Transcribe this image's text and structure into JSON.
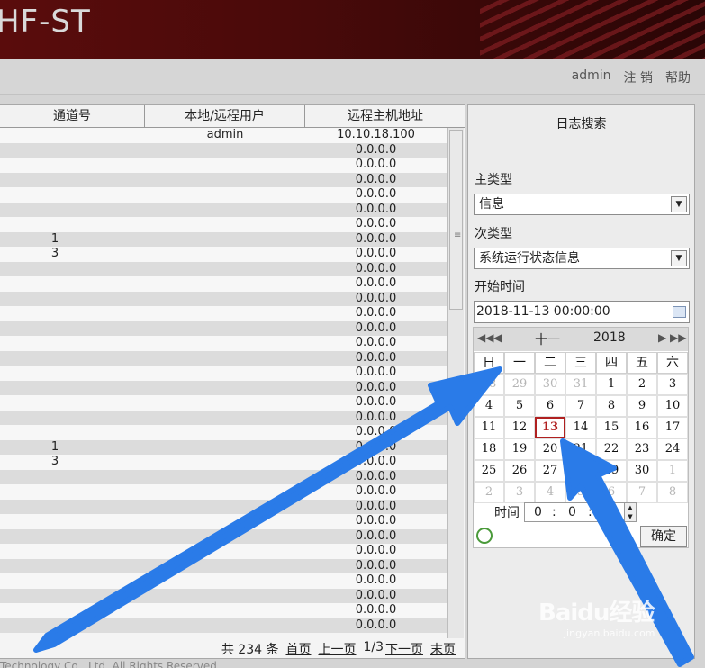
{
  "header": {
    "title": "HF-ST"
  },
  "topnav": {
    "user": "admin",
    "logout": "注 销",
    "help": "帮助"
  },
  "table": {
    "columns": [
      "通道号",
      "本地/远程用户",
      "远程主机地址"
    ],
    "rows": [
      {
        "channel": "",
        "user": "admin",
        "host": "10.10.18.100"
      },
      {
        "channel": "",
        "user": "",
        "host": "0.0.0.0"
      },
      {
        "channel": "",
        "user": "",
        "host": "0.0.0.0"
      },
      {
        "channel": "",
        "user": "",
        "host": "0.0.0.0"
      },
      {
        "channel": "",
        "user": "",
        "host": "0.0.0.0"
      },
      {
        "channel": "",
        "user": "",
        "host": "0.0.0.0"
      },
      {
        "channel": "",
        "user": "",
        "host": "0.0.0.0"
      },
      {
        "channel": "1",
        "user": "",
        "host": "0.0.0.0"
      },
      {
        "channel": "3",
        "user": "",
        "host": "0.0.0.0"
      },
      {
        "channel": "",
        "user": "",
        "host": "0.0.0.0"
      },
      {
        "channel": "",
        "user": "",
        "host": "0.0.0.0"
      },
      {
        "channel": "",
        "user": "",
        "host": "0.0.0.0"
      },
      {
        "channel": "",
        "user": "",
        "host": "0.0.0.0"
      },
      {
        "channel": "",
        "user": "",
        "host": "0.0.0.0"
      },
      {
        "channel": "",
        "user": "",
        "host": "0.0.0.0"
      },
      {
        "channel": "",
        "user": "",
        "host": "0.0.0.0"
      },
      {
        "channel": "",
        "user": "",
        "host": "0.0.0.0"
      },
      {
        "channel": "",
        "user": "",
        "host": "0.0.0.0"
      },
      {
        "channel": "",
        "user": "",
        "host": "0.0.0.0"
      },
      {
        "channel": "",
        "user": "",
        "host": "0.0.0.0"
      },
      {
        "channel": "",
        "user": "",
        "host": "0.0.0.0"
      },
      {
        "channel": "1",
        "user": "",
        "host": "0.0.0.0"
      },
      {
        "channel": "3",
        "user": "",
        "host": "0.0.0.0"
      },
      {
        "channel": "",
        "user": "",
        "host": "0.0.0.0"
      },
      {
        "channel": "",
        "user": "",
        "host": "0.0.0.0"
      },
      {
        "channel": "",
        "user": "",
        "host": "0.0.0.0"
      },
      {
        "channel": "",
        "user": "",
        "host": "0.0.0.0"
      },
      {
        "channel": "",
        "user": "",
        "host": "0.0.0.0"
      },
      {
        "channel": "",
        "user": "",
        "host": "0.0.0.0"
      },
      {
        "channel": "",
        "user": "",
        "host": "0.0.0.0"
      },
      {
        "channel": "",
        "user": "",
        "host": "0.0.0.0"
      },
      {
        "channel": "",
        "user": "",
        "host": "0.0.0.0"
      },
      {
        "channel": "",
        "user": "",
        "host": "0.0.0.0"
      },
      {
        "channel": "",
        "user": "",
        "host": "0.0.0.0"
      }
    ]
  },
  "pager": {
    "total": "共 234 条",
    "first": "首页",
    "prev": "上一页",
    "page": "1/3",
    "next": "下一页",
    "last": "末页"
  },
  "footer": {
    "copyright": "Technology Co., Ltd. All Rights Reserved"
  },
  "search_panel": {
    "title": "日志搜索",
    "main_type_label": "主类型",
    "main_type_value": "信息",
    "sub_type_label": "次类型",
    "sub_type_value": "系统运行状态信息",
    "start_time_label": "开始时间",
    "start_time_value": "2018-11-13 00:00:00",
    "ok_label": "确定"
  },
  "calendar": {
    "month": "十一",
    "year": "2018",
    "weekdays": [
      "日",
      "一",
      "二",
      "三",
      "四",
      "五",
      "六"
    ],
    "weeks": [
      [
        {
          "d": "28",
          "dim": true
        },
        {
          "d": "29",
          "dim": true
        },
        {
          "d": "30",
          "dim": true
        },
        {
          "d": "31",
          "dim": true
        },
        {
          "d": "1"
        },
        {
          "d": "2"
        },
        {
          "d": "3"
        }
      ],
      [
        {
          "d": "4"
        },
        {
          "d": "5"
        },
        {
          "d": "6"
        },
        {
          "d": "7"
        },
        {
          "d": "8"
        },
        {
          "d": "9"
        },
        {
          "d": "10"
        }
      ],
      [
        {
          "d": "11"
        },
        {
          "d": "12"
        },
        {
          "d": "13",
          "today": true
        },
        {
          "d": "14"
        },
        {
          "d": "15"
        },
        {
          "d": "16"
        },
        {
          "d": "17"
        }
      ],
      [
        {
          "d": "18"
        },
        {
          "d": "19"
        },
        {
          "d": "20"
        },
        {
          "d": "21"
        },
        {
          "d": "22"
        },
        {
          "d": "23"
        },
        {
          "d": "24"
        }
      ],
      [
        {
          "d": "25"
        },
        {
          "d": "26"
        },
        {
          "d": "27"
        },
        {
          "d": "28"
        },
        {
          "d": "29"
        },
        {
          "d": "30"
        },
        {
          "d": "1",
          "dim": true
        }
      ],
      [
        {
          "d": "2",
          "dim": true
        },
        {
          "d": "3",
          "dim": true
        },
        {
          "d": "4",
          "dim": true
        },
        {
          "d": "5",
          "dim": true
        },
        {
          "d": "6",
          "dim": true
        },
        {
          "d": "7",
          "dim": true
        },
        {
          "d": "8",
          "dim": true
        }
      ]
    ],
    "time_label": "时间",
    "time_hour": "0",
    "time_minute": "0"
  },
  "watermark": {
    "brand": "Baidu经验",
    "url": "jingyan.baidu.com"
  },
  "colors": {
    "banner": "#4a0a0a",
    "arrow": "#2a7be8",
    "today": "#b02020"
  }
}
